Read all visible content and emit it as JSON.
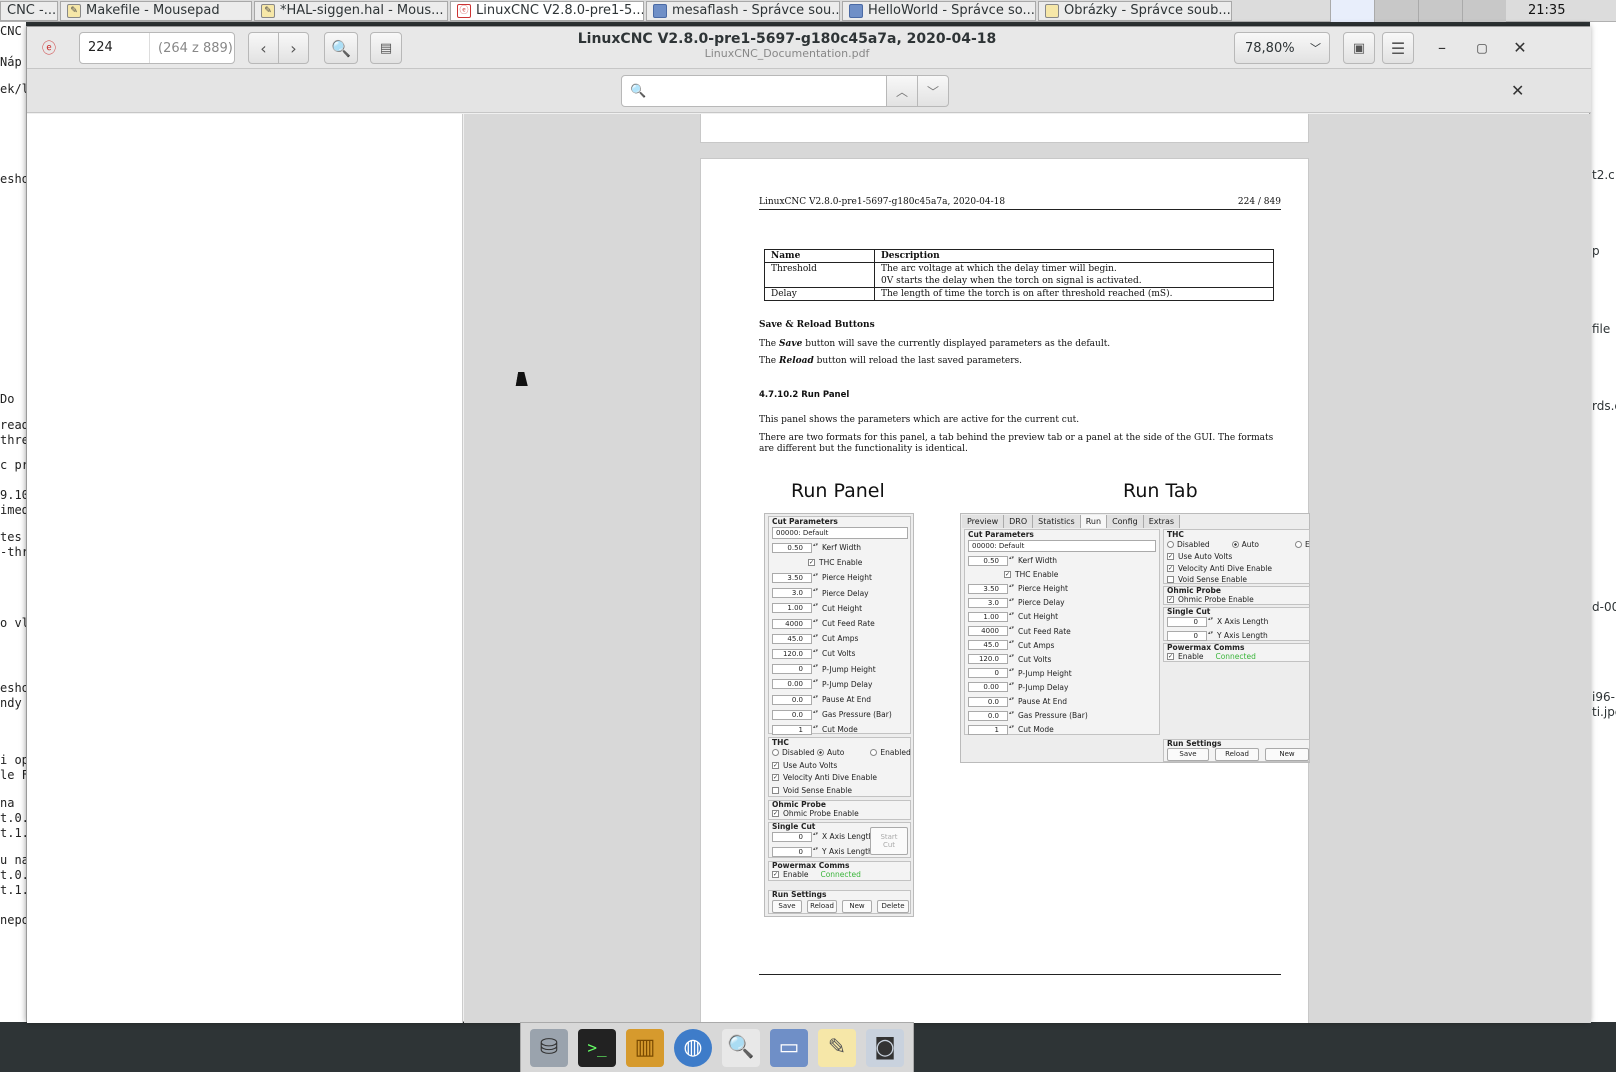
{
  "taskbar": {
    "tasks": [
      {
        "label": "CNC -...",
        "icon": "pdf-icon",
        "active": false
      },
      {
        "label": "Makefile - Mousepad",
        "icon": "text-editor-icon",
        "active": false
      },
      {
        "label": "*HAL-siggen.hal - Mous...",
        "icon": "text-editor-icon",
        "active": false
      },
      {
        "label": "LinuxCNC V2.8.0-pre1-5...",
        "icon": "pdf-icon",
        "active": true
      },
      {
        "label": "mesaflash - Správce sou...",
        "icon": "folder-icon",
        "active": false
      },
      {
        "label": "HelloWorld - Správce so...",
        "icon": "folder-icon",
        "active": false
      },
      {
        "label": "Obrázky - Správce soub...",
        "icon": "folder-icon",
        "active": false
      }
    ],
    "clock": "21:35"
  },
  "viewer": {
    "page_input": "224",
    "page_total": "(264 z 889)",
    "title": "LinuxCNC V2.8.0-pre1-5697-g180c45a7a, 2020-04-18",
    "filename": "LinuxCNC_Documentation.pdf",
    "zoom": "78,80%",
    "search_value": ""
  },
  "bg_left_lines": [
    "CNC -",
    "Náp",
    "ek/lin",
    "esho",
    "Do",
    "read",
    "thre",
    "c pr",
    "9.10",
    "imed",
    "tes",
    "-thr",
    "o vl",
    "esho",
    "ndy",
    "i op",
    "le F",
    "na",
    "t.0.",
    "t.1.",
    "u na",
    "t.0.",
    "t.1.",
    "nepo"
  ],
  "bg_right_lines": [
    "t2.c",
    "p",
    "file",
    "rds.c",
    "d-00",
    "i96-",
    "ti.jpe"
  ],
  "pdf": {
    "header_left": "LinuxCNC V2.8.0-pre1-5697-g180c45a7a, 2020-04-18",
    "header_right": "224 / 849",
    "table": {
      "headers": [
        "Name",
        "Description"
      ],
      "rows": [
        [
          "Threshold",
          "The arc voltage at which the delay timer will begin.",
          "0V starts the delay when the torch on signal is activated."
        ],
        [
          "Delay",
          "The length of time the torch is on after threshold reached (mS).",
          ""
        ]
      ]
    },
    "save_reload_heading": "Save & Reload Buttons",
    "save_line_a": "The",
    "save_word": "Save",
    "save_line_b": "button will save the currently displayed parameters as the default.",
    "reload_line_a": "The",
    "reload_word": "Reload",
    "reload_line_b": "button will reload the last saved parameters.",
    "section_heading": "4.7.10.2   Run Panel",
    "para1": "This panel shows the parameters which are active for the current cut.",
    "para2": "There are two formats for this panel, a tab behind the preview tab or a panel at the side of the GUI. The formats are different but the functionality is identical.",
    "run_panel_title": "Run Panel",
    "run_tab_title": "Run Tab"
  },
  "run_panel": {
    "cut_params_title": "Cut Parameters",
    "material": "00000: Default",
    "params": [
      {
        "value": "0.50",
        "label": "Kerf Width"
      },
      {
        "value": "",
        "label": "THC Enable",
        "check": true
      },
      {
        "value": "3.50",
        "label": "Pierce Height"
      },
      {
        "value": "3.0",
        "label": "Pierce Delay"
      },
      {
        "value": "1.00",
        "label": "Cut Height"
      },
      {
        "value": "4000",
        "label": "Cut Feed Rate"
      },
      {
        "value": "45.0",
        "label": "Cut Amps"
      },
      {
        "value": "120.0",
        "label": "Cut Volts"
      },
      {
        "value": "0",
        "label": "P-Jump Height"
      },
      {
        "value": "0.00",
        "label": "P-Jump Delay"
      },
      {
        "value": "0.0",
        "label": "Pause At End"
      },
      {
        "value": "0.0",
        "label": "Gas Pressure (Bar)"
      },
      {
        "value": "1",
        "label": "Cut Mode"
      }
    ],
    "thc_title": "THC",
    "thc_disabled": "Disabled",
    "thc_auto": "Auto",
    "thc_enabled": "Enabled",
    "use_auto_volts": "Use Auto Volts",
    "velocity_anti_dive": "Velocity Anti Dive Enable",
    "void_sense": "Void Sense Enable",
    "ohmic_title": "Ohmic Probe",
    "ohmic_enable": "Ohmic Probe Enable",
    "single_cut_title": "Single Cut",
    "x_len_value": "0",
    "x_len_label": "X Axis Length",
    "y_len_value": "0",
    "y_len_label": "Y Axis Length",
    "start_cut_a": "Start",
    "start_cut_b": "Cut",
    "pmx_title": "Powermax Comms",
    "pmx_enable": "Enable",
    "pmx_status": "Connected",
    "settings_title": "Run Settings",
    "btn_save": "Save",
    "btn_reload": "Reload",
    "btn_new": "New",
    "btn_delete": "Delete"
  },
  "run_tab": {
    "tabs": [
      "Preview",
      "DRO",
      "Statistics",
      "Run",
      "Config",
      "Extras"
    ],
    "active_tab": "Run",
    "thc_partial": "E"
  },
  "dock": {
    "items": [
      "drive-icon",
      "terminal-icon",
      "file-manager-icon",
      "web-browser-icon",
      "search-icon",
      "folder-icon",
      "text-editor-icon",
      "screenshot-icon"
    ]
  },
  "colors": {
    "connected": "#3bb53b",
    "panel_bg": "#ededed",
    "page_bg": "#ffffff",
    "viewer_bg": "#d8d8d8"
  }
}
